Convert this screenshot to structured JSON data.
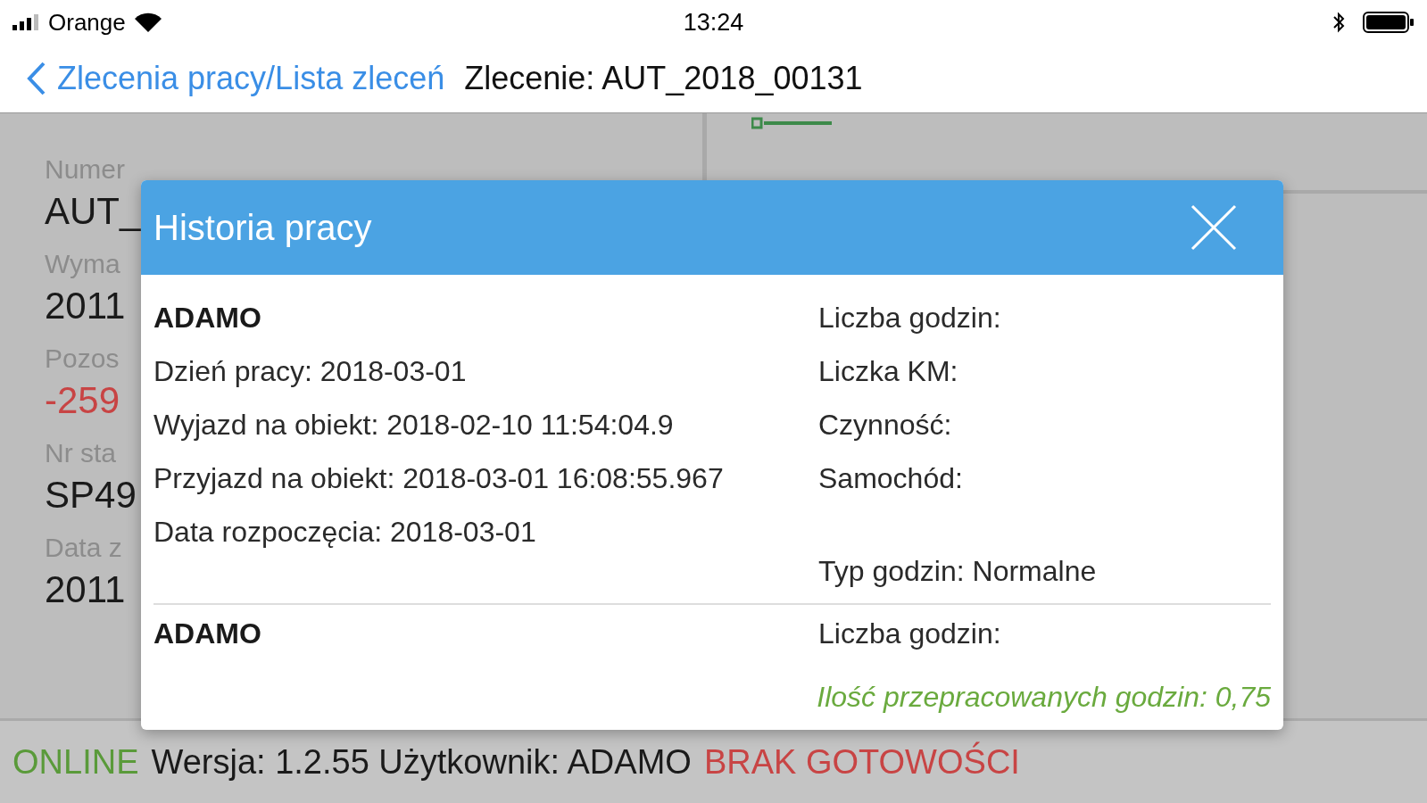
{
  "status_bar": {
    "carrier": "Orange",
    "time": "13:24"
  },
  "nav": {
    "back": "Zlecenia pracy/Lista zleceń",
    "title": "Zlecenie: AUT_2018_00131"
  },
  "details": [
    {
      "kind": "label",
      "text": "Numer"
    },
    {
      "kind": "value",
      "text": "AUT_"
    },
    {
      "kind": "label",
      "text": "Wyma"
    },
    {
      "kind": "value",
      "text": "2011"
    },
    {
      "kind": "label",
      "text": "Pozos"
    },
    {
      "kind": "alert",
      "text": "-259"
    },
    {
      "kind": "label",
      "text": "Nr sta"
    },
    {
      "kind": "value",
      "text": "SP49"
    },
    {
      "kind": "label",
      "text": "Data z"
    },
    {
      "kind": "value",
      "text": "2011"
    }
  ],
  "dialog": {
    "title": "Historia pracy",
    "entries": [
      {
        "worker": "ADAMO",
        "left": [
          "Dzień pracy: 2018-03-01",
          "Wyjazd na obiekt: 2018-02-10 11:54:04.9",
          "Przyjazd na obiekt: 2018-03-01 16:08:55.967",
          "Data rozpoczęcia: 2018-03-01"
        ],
        "right": [
          "Liczba godzin:",
          "Liczka KM:",
          "Czynność:",
          "Samochód:",
          "Typ godzin: Normalne"
        ]
      },
      {
        "worker": "ADAMO",
        "right": [
          "Liczba godzin:"
        ]
      }
    ],
    "total": "Ilość przepracowanych godzin: 0,75"
  },
  "footer": {
    "connection": "ONLINE",
    "info": "Wersja: 1.2.55 Użytkownik: ADAMO",
    "readiness": "BRAK GOTOWOŚCI"
  }
}
